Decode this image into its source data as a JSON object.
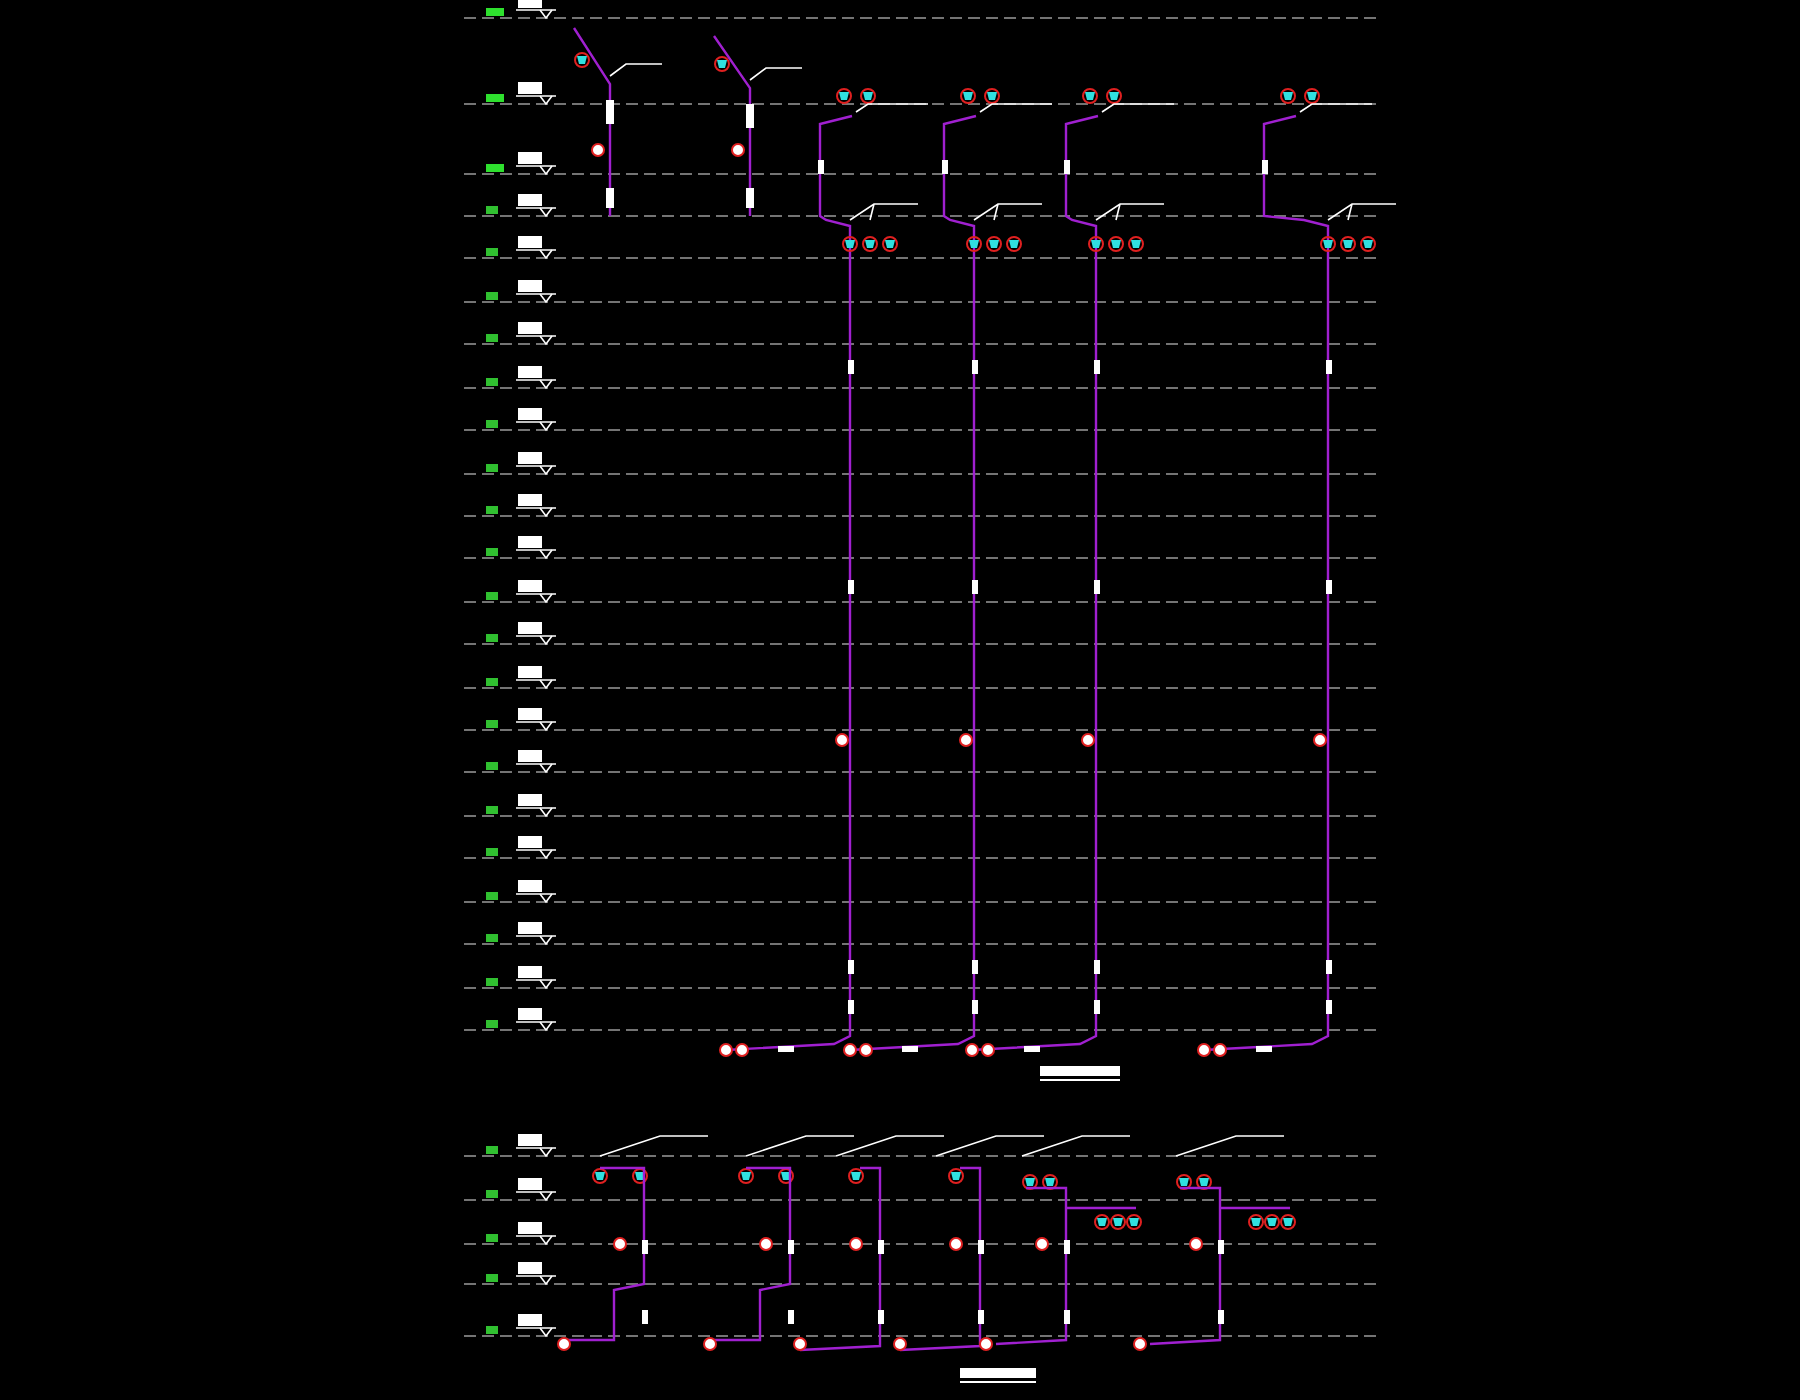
{
  "drawing": {
    "upper": {
      "levels": [
        {
          "kind": "roof"
        },
        {
          "kind": "roof"
        },
        {
          "kind": "roof"
        },
        {
          "kind": "floor"
        },
        {
          "kind": "floor"
        },
        {
          "kind": "floor"
        },
        {
          "kind": "floor"
        },
        {
          "kind": "floor"
        },
        {
          "kind": "floor"
        },
        {
          "kind": "floor"
        },
        {
          "kind": "floor"
        },
        {
          "kind": "floor"
        },
        {
          "kind": "floor"
        },
        {
          "kind": "floor"
        },
        {
          "kind": "floor"
        },
        {
          "kind": "floor"
        },
        {
          "kind": "floor"
        },
        {
          "kind": "floor"
        },
        {
          "kind": "floor"
        },
        {
          "kind": "floor"
        },
        {
          "kind": "floor"
        },
        {
          "kind": "floor"
        },
        {
          "kind": "floor"
        }
      ],
      "risers": [
        {
          "kind": "short"
        },
        {
          "kind": "short"
        },
        {
          "kind": "tall"
        },
        {
          "kind": "tall"
        },
        {
          "kind": "tall"
        },
        {
          "kind": "tall"
        }
      ]
    },
    "lower": {
      "levels": [
        {
          "kind": "floor"
        },
        {
          "kind": "floor"
        },
        {
          "kind": "floor"
        },
        {
          "kind": "floor"
        },
        {
          "kind": "floor"
        }
      ],
      "risers": [
        {
          "kind": "offset"
        },
        {
          "kind": "offset"
        },
        {
          "kind": "straight"
        },
        {
          "kind": "straight"
        },
        {
          "kind": "loop"
        },
        {
          "kind": "loop"
        }
      ]
    }
  }
}
